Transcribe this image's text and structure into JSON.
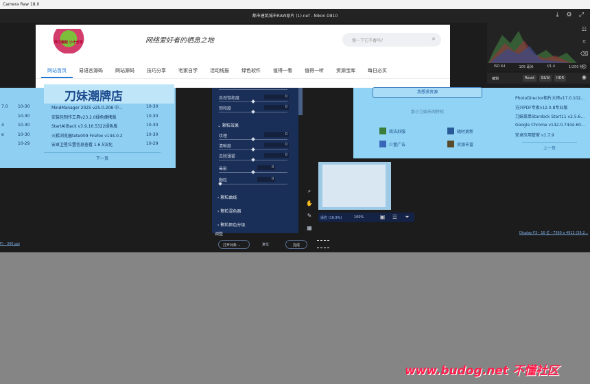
{
  "app_title": "Camera Raw 18.0",
  "document_title": "都市建筑城市RAW原片 (1).nef - Nikon D810",
  "website": {
    "logo_text": "昨刀崛起 小十分享",
    "slogan": "网络爱好者的栖息之地",
    "search_placeholder": "搜一下它不香吗?",
    "nav": [
      "网站首页",
      "易语言源码",
      "网站源码",
      "技巧分享",
      "宅家自学",
      "活动线报",
      "绿色软件",
      "值得一看",
      "值得一听",
      "资源宝库",
      "每日必买"
    ],
    "nav_active": 0
  },
  "blue_panel": {
    "heading": "刀妹潮牌店",
    "rows": [
      {
        "idx": "7.0",
        "d1": "10-30",
        "name": "MindManager 2025 v25.0.208 中...",
        "d2": "10-30"
      },
      {
        "idx": "",
        "d1": "10-30",
        "name": "安装包制作工具v23.2.0绿色便携版",
        "d2": "10-30"
      },
      {
        "idx": "4",
        "d1": "10-30",
        "name": "StartAllBack v3.9.16.5322绿色版",
        "d2": "10-30"
      },
      {
        "idx": "e",
        "d1": "10-30",
        "name": "火狐浏览器tete009 Firefox v144.0.2",
        "d2": "10-30"
      },
      {
        "idx": "",
        "d1": "10-29",
        "name": "安卓卫星位置信息查看 1.6.5汉化",
        "d2": "10-29"
      }
    ],
    "next_page": "下一页"
  },
  "right_web": {
    "button": "我想求资源",
    "subtitle": "那小刀娱乐网特权",
    "items": [
      "简洁舒服",
      "随时更新",
      "少量广告",
      "资源丰富"
    ],
    "list": [
      "PhotoDirector相片大师v17.0.102...",
      "万兴PDF专家v12.0.8专业版",
      "刀妹菜单Stardock Start11 v2.5.6...",
      "Google Chrome v142.0.7444.60...",
      "安卓应用管家 v1.7.9"
    ],
    "prev_page": "上一页"
  },
  "edit_panel": {
    "sliders_top": [
      {
        "label": "自然饱和度",
        "value": "0"
      },
      {
        "label": "饱和度",
        "value": "0"
      }
    ],
    "section_effects": "颗粒效果",
    "sliders_effects": [
      {
        "label": "纹理",
        "value": "0"
      },
      {
        "label": "清晰度",
        "value": "0"
      },
      {
        "label": "去除薄雾",
        "value": "0"
      },
      {
        "label": "晕影",
        "value": "0"
      },
      {
        "label": "颗粒",
        "value": "0"
      }
    ],
    "sections": [
      "颗粒曲线",
      "颗粒混色器",
      "颗粒颜色分级"
    ],
    "color_grading_label": "调整"
  },
  "zoom": {
    "label": "适应 (16.9%)",
    "value": "100%"
  },
  "display_info": "Display P3 - 16 位 - 7360 x 4912 (36.2...",
  "ppi_info": "P) - 300 ppi",
  "buttons": {
    "open": "打开对象",
    "reset": "复位",
    "done": "完成"
  },
  "histogram_info": [
    "ISO 64",
    "105 毫米",
    "f/1.4",
    "1/250 秒"
  ],
  "edit_bar": {
    "label": "编辑",
    "reset": "Reset",
    "bw": "B&W",
    "hdr": "HDR"
  },
  "watermark": "www.budog.net 不懂社区"
}
